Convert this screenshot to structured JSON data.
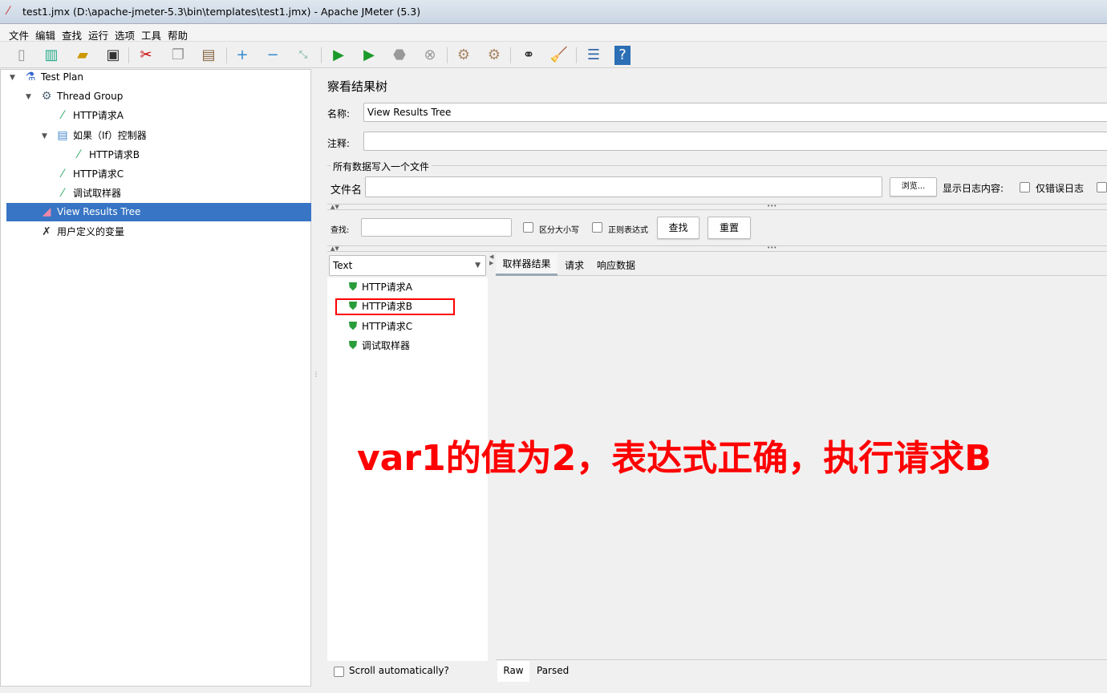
{
  "window": {
    "title": "test1.jmx (D:\\apache-jmeter-5.3\\bin\\templates\\test1.jmx) - Apache JMeter (5.3)"
  },
  "menu": [
    "文件",
    "编辑",
    "查找",
    "运行",
    "选项",
    "工具",
    "帮助"
  ],
  "toolbar": [
    "new-icon",
    "templates-icon",
    "open-icon",
    "save-icon",
    "cut-icon",
    "copy-icon",
    "paste-icon",
    "expand-icon",
    "collapse-icon",
    "toggle-icon",
    "start-icon",
    "start-no-pause-icon",
    "stop-icon",
    "shutdown-icon",
    "clear-icon",
    "clear-all-icon",
    "search-icon",
    "reset-search-icon",
    "function-helper-icon",
    "help-icon"
  ],
  "tree": [
    {
      "label": "Test Plan",
      "icon": "flask-icon"
    },
    {
      "label": "Thread Group",
      "icon": "gear-icon"
    },
    {
      "label": "HTTP请求A",
      "icon": "pipette-icon"
    },
    {
      "label": "如果（If）控制器",
      "icon": "if-controller-icon"
    },
    {
      "label": "HTTP请求B",
      "icon": "pipette-icon"
    },
    {
      "label": "HTTP请求C",
      "icon": "pipette-icon"
    },
    {
      "label": "调试取样器",
      "icon": "pipette-icon"
    },
    {
      "label": "View Results Tree",
      "icon": "chart-icon"
    },
    {
      "label": "用户定义的变量",
      "icon": "wrench-icon"
    }
  ],
  "panel": {
    "title": "察看结果树",
    "name_label": "名称:",
    "name_value": "View Results Tree",
    "comment_label": "注释:",
    "comment_value": "",
    "file_section": "所有数据写入一个文件",
    "filename_label": "文件名",
    "filename_value": "",
    "browse": "浏览...",
    "log_label": "显示日志内容:",
    "errors_only": "仅错误日志",
    "search_label": "查找:",
    "search_value": "",
    "case_sensitive": "区分大小写",
    "regex": "正则表达式",
    "search_btn": "查找",
    "reset_btn": "重置",
    "renderer": "Text",
    "results": [
      "HTTP请求A",
      "HTTP请求B",
      "HTTP请求C",
      "调试取样器"
    ],
    "tabs": [
      "取样器结果",
      "请求",
      "响应数据"
    ],
    "bottom_tabs": [
      "Raw",
      "Parsed"
    ],
    "scroll_auto": "Scroll automatically?"
  },
  "annotation": "var1的值为2，表达式正确，执行请求B",
  "colors": {
    "selection": "#3875c4",
    "annotation": "#ff0000",
    "success": "#2a9d3a"
  }
}
